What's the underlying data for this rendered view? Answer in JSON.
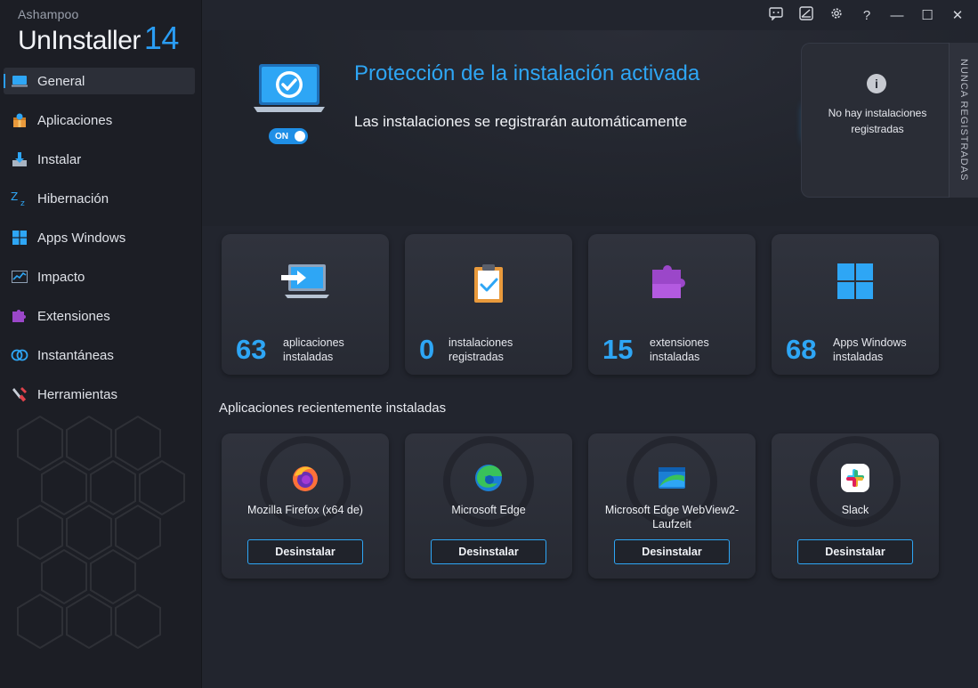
{
  "brand": {
    "vendor": "Ashampoo",
    "product": "UnInstaller",
    "version": "14"
  },
  "window_controls": {
    "feedback": "feedback-icon",
    "skin": "theme-icon",
    "settings": "gear-icon",
    "help": "?",
    "minimize": "—",
    "maximize": "☐",
    "close": "✕"
  },
  "sidebar": {
    "items": [
      {
        "label": "General",
        "icon": "monitor-icon",
        "active": true
      },
      {
        "label": "Aplicaciones",
        "icon": "package-icon"
      },
      {
        "label": "Instalar",
        "icon": "install-icon"
      },
      {
        "label": "Hibernación",
        "icon": "sleep-icon"
      },
      {
        "label": "Apps Windows",
        "icon": "windows-icon"
      },
      {
        "label": "Impacto",
        "icon": "chart-icon"
      },
      {
        "label": "Extensiones",
        "icon": "puzzle-icon"
      },
      {
        "label": "Instantáneas",
        "icon": "snapshot-icon"
      },
      {
        "label": "Herramientas",
        "icon": "tools-icon"
      }
    ]
  },
  "hero": {
    "title": "Protección de la instalación activada",
    "subtitle": "Las instalaciones se registrarán automáticamente",
    "toggle_label": "ON",
    "toggle_on": true
  },
  "registered_panel": {
    "message": "No hay instalaciones registradas",
    "tab_label": "NUNCA REGISTRADAS"
  },
  "stats": [
    {
      "value": "63",
      "line1": "aplicaciones",
      "line2": "instaladas",
      "icon": "laptop-arrow-icon"
    },
    {
      "value": "0",
      "line1": "instalaciones",
      "line2": "registradas",
      "icon": "clipboard-check-icon"
    },
    {
      "value": "15",
      "line1": "extensiones",
      "line2": "instaladas",
      "icon": "puzzle-icon"
    },
    {
      "value": "68",
      "line1": "Apps Windows",
      "line2": "instaladas",
      "icon": "windows-icon"
    }
  ],
  "recent": {
    "title": "Aplicaciones recientemente instaladas",
    "button_label": "Desinstalar",
    "apps": [
      {
        "name": "Mozilla Firefox (x64 de)",
        "icon": "firefox-icon"
      },
      {
        "name": "Microsoft Edge",
        "icon": "edge-icon"
      },
      {
        "name": "Microsoft Edge WebView2-Laufzeit",
        "icon": "edge-webview-icon"
      },
      {
        "name": "Slack",
        "icon": "slack-icon"
      }
    ]
  },
  "colors": {
    "accent": "#2ea6f5",
    "background": "#22252e",
    "sidebar": "#1c1e25",
    "card": "#2c2f38"
  }
}
